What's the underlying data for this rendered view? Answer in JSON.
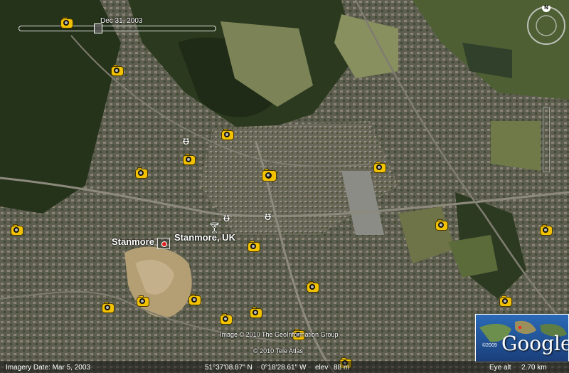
{
  "time_slider": {
    "date": "Dec 31, 2003",
    "position": 0.4
  },
  "place_labels": {
    "stanmore": "Stanmore",
    "stanmore_uk": "Stanmore, UK"
  },
  "attribution": {
    "line1": "Image © 2010 The GeoInformation Group",
    "line2": "© 2010 Tele Atlas"
  },
  "logo": {
    "copyright": "©2009",
    "name": "Google"
  },
  "navigation": {
    "north_label": "N"
  },
  "status_bar": {
    "imagery_date": "Imagery Date: Mar  5, 2003",
    "latitude": "51°37'08.87\" N",
    "longitude": "0°18'28.61\" W",
    "elevation_label": "elev",
    "elevation": "88 m",
    "eye_alt_label": "Eye alt",
    "eye_alt": "2.70 km"
  },
  "icons": {
    "photo_marker": "camera-icon",
    "restaurant": "restaurant-icon",
    "bar": "bar-icon",
    "place": "place-target-icon"
  },
  "colors": {
    "marker_fill": "#f2c200",
    "label_text": "#ffffff",
    "vegetation": "#2b3a1e",
    "urban": "#6b6a5c"
  }
}
